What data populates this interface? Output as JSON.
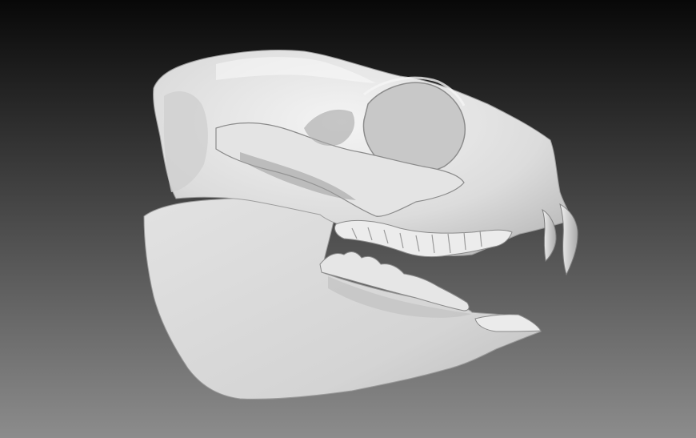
{
  "viewport": {
    "background_top": "#080808",
    "background_bottom": "#8c8c8c",
    "model_color": "#d9d9d9",
    "model_highlight": "#f2f2f2",
    "model_shadow": "#8f8f8f"
  },
  "model": {
    "subject": "skull-3d-scan"
  }
}
